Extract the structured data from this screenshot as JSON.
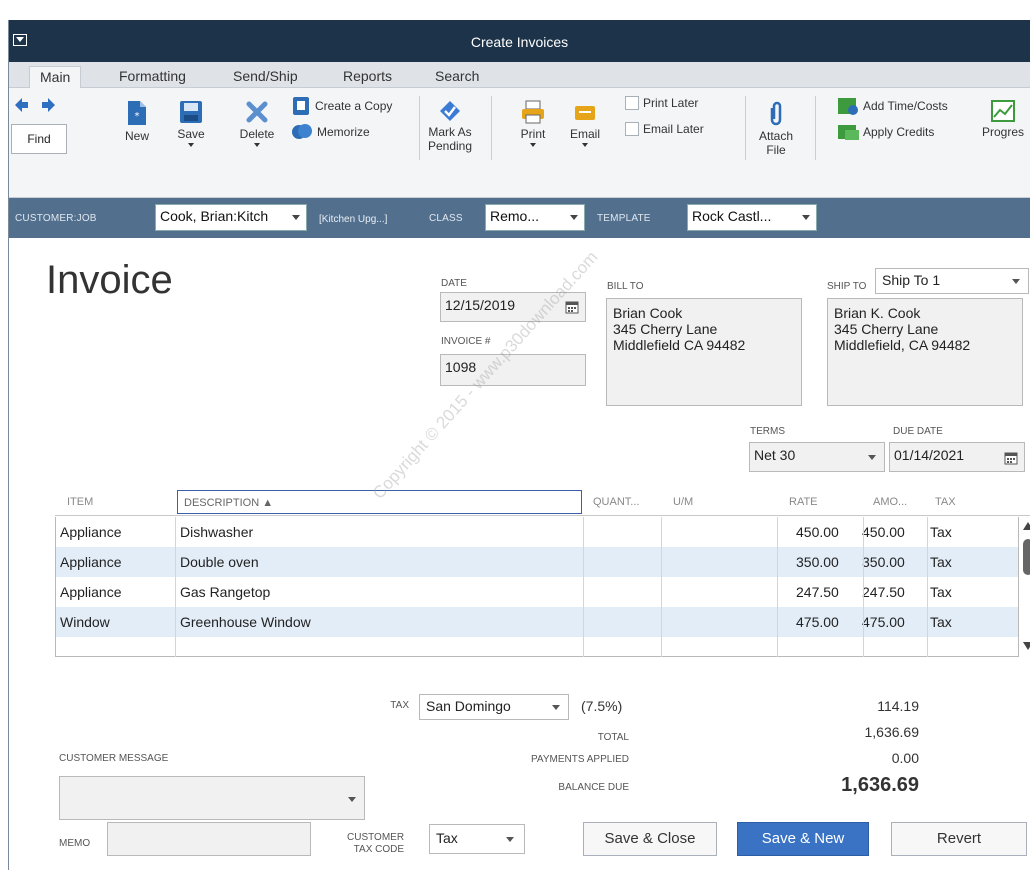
{
  "window": {
    "title": "Create Invoices"
  },
  "tabs": [
    "Main",
    "Formatting",
    "Send/Ship",
    "Reports",
    "Search"
  ],
  "toolbar": {
    "find": "Find",
    "new": "New",
    "save": "Save",
    "delete": "Delete",
    "create_copy": "Create a Copy",
    "memorize": "Memorize",
    "mark_as_pending": [
      "Mark As",
      "Pending"
    ],
    "print": "Print",
    "email": "Email",
    "print_later": "Print Later",
    "email_later": "Email Later",
    "attach_file": [
      "Attach",
      "File"
    ],
    "add_time_costs": "Add Time/Costs",
    "apply_credits": "Apply Credits",
    "progress": "Progres"
  },
  "customer_bar": {
    "customer_job_label": "CUSTOMER:JOB",
    "customer_job_value": "Cook, Brian:Kitch",
    "job_note": "[Kitchen Upg...]",
    "class_label": "CLASS",
    "class_value": "Remo...",
    "template_label": "TEMPLATE",
    "template_value": "Rock Castl..."
  },
  "form": {
    "title": "Invoice",
    "date_label": "DATE",
    "date_value": "12/15/2019",
    "invoice_no_label": "INVOICE #",
    "invoice_no_value": "1098",
    "bill_to_label": "BILL TO",
    "bill_to_lines": [
      "Brian Cook",
      "345 Cherry Lane",
      "Middlefield CA 94482"
    ],
    "ship_to_label": "SHIP TO",
    "ship_to_select": "Ship To 1",
    "ship_to_lines": [
      "Brian K. Cook",
      "345 Cherry Lane",
      "Middlefield, CA 94482"
    ],
    "terms_label": "TERMS",
    "terms_value": "Net 30",
    "due_date_label": "DUE DATE",
    "due_date_value": "01/14/2021"
  },
  "grid": {
    "columns": [
      "ITEM",
      "DESCRIPTION ▲",
      "QUANT...",
      "U/M",
      "RATE",
      "AMO...",
      "TAX"
    ],
    "rows": [
      {
        "item": "Appliance",
        "description": "Dishwasher",
        "quantity": "",
        "um": "",
        "rate": "450.00",
        "amount": "450.00",
        "tax": "Tax"
      },
      {
        "item": "Appliance",
        "description": "Double oven",
        "quantity": "",
        "um": "",
        "rate": "350.00",
        "amount": "350.00",
        "tax": "Tax"
      },
      {
        "item": "Appliance",
        "description": "Gas Rangetop",
        "quantity": "",
        "um": "",
        "rate": "247.50",
        "amount": "247.50",
        "tax": "Tax"
      },
      {
        "item": "Window",
        "description": "Greenhouse Window",
        "quantity": "",
        "um": "",
        "rate": "475.00",
        "amount": "475.00",
        "tax": "Tax"
      }
    ]
  },
  "totals": {
    "tax_label": "TAX",
    "tax_select": "San Domingo",
    "tax_rate": "(7.5%)",
    "tax_amount": "114.19",
    "total_label": "TOTAL",
    "total_value": "1,636.69",
    "payments_label": "PAYMENTS APPLIED",
    "payments_value": "0.00",
    "balance_label": "BALANCE DUE",
    "balance_value": "1,636.69"
  },
  "footer": {
    "customer_message_label": "CUSTOMER MESSAGE",
    "memo_label": "MEMO",
    "customer_tax_code_label": [
      "CUSTOMER",
      "TAX CODE"
    ],
    "tax_code_value": "Tax",
    "save_close": "Save & Close",
    "save_new": "Save & New",
    "revert": "Revert"
  },
  "watermark": "Copyright © 2015 - www.p30download.com",
  "colors": {
    "titlebar": "#1d3349",
    "customer_bar": "#52708e",
    "row_alt": "#e3edf8",
    "primary_button": "#3a73c4"
  }
}
